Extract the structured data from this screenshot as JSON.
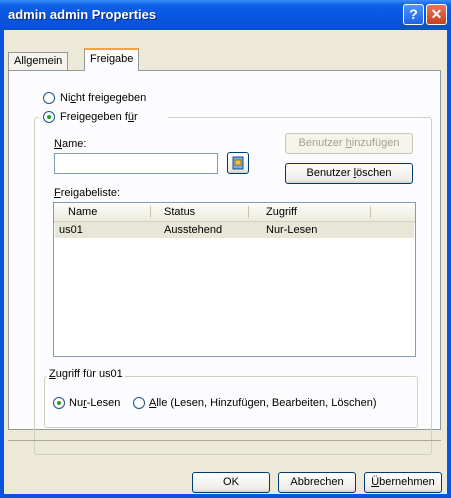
{
  "window": {
    "title": "admin admin Properties",
    "help_glyph": "?",
    "close_glyph": "✕"
  },
  "tabs": [
    {
      "label": "Allgemein",
      "active": false
    },
    {
      "label": "Freigabe",
      "active": true
    }
  ],
  "sharing": {
    "not_shared": {
      "pre": "Ni",
      "accel": "c",
      "post": "ht freigegeben",
      "selected": false
    },
    "shared_for": {
      "pre": "Freigegeben f",
      "accel": "ü",
      "post": "r",
      "selected": true
    },
    "name_label": {
      "accel": "N",
      "post": "ame:"
    },
    "name_value": "",
    "add_button": {
      "pre": "Benutzer ",
      "accel": "h",
      "post": "inzufügen",
      "enabled": false
    },
    "remove_button": {
      "pre": "Benutzer ",
      "accel": "l",
      "post": "öschen",
      "enabled": true
    },
    "list_label": {
      "accel": "F",
      "post": "reigabeliste:"
    },
    "columns": [
      "Name",
      "Status",
      "Zugriff"
    ],
    "rows": [
      {
        "name": "us01",
        "status": "Ausstehend",
        "access": "Nur-Lesen",
        "selected": true
      }
    ]
  },
  "access_group": {
    "legend": {
      "accel": "Z",
      "post": "ugriff für us01"
    },
    "readonly": {
      "pre": "Nu",
      "accel": "r",
      "post": "-Lesen",
      "selected": true
    },
    "all": {
      "accel": "A",
      "post": "lle (Lesen, Hinzufügen, Bearbeiten, Löschen)",
      "selected": false
    }
  },
  "footer": {
    "ok": "OK",
    "cancel": "Abbrechen",
    "apply": {
      "accel": "Ü",
      "post": "bernehmen"
    }
  },
  "colors": {
    "titlebar": "#0a55e0",
    "dialog": "#ece9d8",
    "radio_dot": "#21a121",
    "tab_highlight": "#f2a33c"
  }
}
